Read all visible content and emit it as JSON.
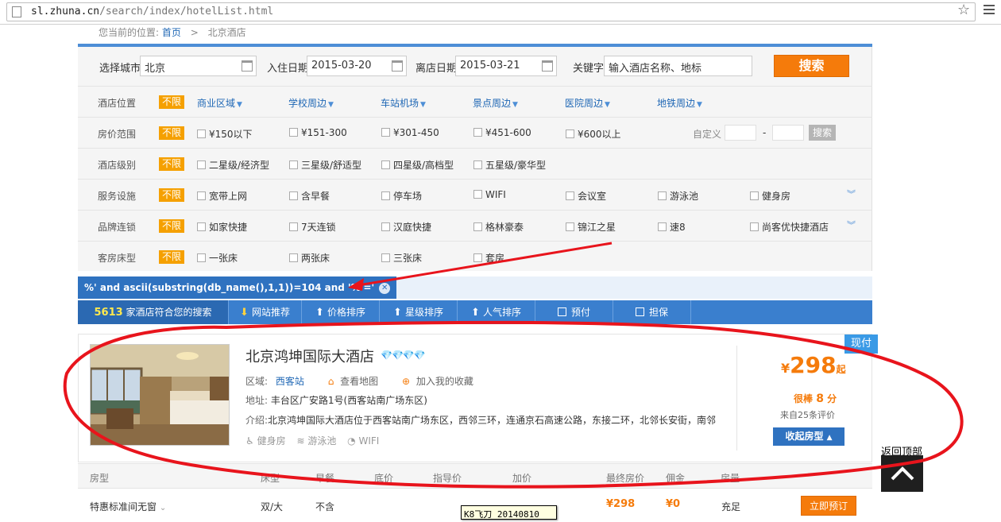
{
  "browser": {
    "url_host": "sl.zhuna.cn",
    "url_path": "/search/index/hotelList.html"
  },
  "breadcrumb": {
    "prefix": "您当前的位置:",
    "home": "首页",
    "sep": ">",
    "current": "北京酒店"
  },
  "search": {
    "city_label": "选择城市",
    "city_value": "北京",
    "checkin_label": "入住日期",
    "checkin_value": "2015-03-20",
    "checkout_label": "离店日期",
    "checkout_value": "2015-03-21",
    "keyword_label": "关键字",
    "keyword_placeholder": "输入酒店名称、地标",
    "button": "搜索"
  },
  "filters": {
    "unlimited": "不限",
    "location": {
      "label": "酒店位置",
      "options": [
        "商业区域",
        "学校周边",
        "车站机场",
        "景点周边",
        "医院周边",
        "地铁周边"
      ]
    },
    "price": {
      "label": "房价范围",
      "options": [
        "¥150以下",
        "¥151-300",
        "¥301-450",
        "¥451-600",
        "¥600以上"
      ],
      "custom_label": "自定义",
      "dash": "-",
      "custom_button": "搜索"
    },
    "star": {
      "label": "酒店级别",
      "options": [
        "二星级/经济型",
        "三星级/舒适型",
        "四星级/高档型",
        "五星级/豪华型"
      ]
    },
    "facility": {
      "label": "服务设施",
      "options": [
        "宽带上网",
        "含早餐",
        "停车场",
        "WIFI",
        "会议室",
        "游泳池",
        "健身房"
      ]
    },
    "brand": {
      "label": "品牌连锁",
      "options": [
        "如家快捷",
        "7天连锁",
        "汉庭快捷",
        "格林豪泰",
        "锦江之星",
        "速8",
        "尚客优快捷酒店"
      ]
    },
    "bed": {
      "label": "客房床型",
      "options": [
        "一张床",
        "两张床",
        "三张床",
        "套房"
      ]
    }
  },
  "active_tag": "%' and ascii(substring(db_name(),1,1))=104 and '%'='",
  "sortbar": {
    "count": "5613",
    "count_suffix": "家酒店符合您的搜索",
    "items": [
      "网站推荐",
      "价格排序",
      "星级排序",
      "人气排序",
      "预付",
      "担保"
    ]
  },
  "hotel": {
    "name": "北京鸿坤国际大酒店",
    "stars": 4,
    "district_label": "区域:",
    "district": "西客站",
    "map_link": "查看地图",
    "fav_link": "加入我的收藏",
    "address_label": "地址:",
    "address": "丰台区广安路1号(西客站南广场东区)",
    "intro_label": "介绍:",
    "intro": "北京鸿坤国际大酒店位于西客站南广场东区，西邻三环，连通京石高速公路，东接二环，北邻长安街，南邻",
    "facilities": [
      "健身房",
      "游泳池",
      "WIFI"
    ],
    "badge": "现付",
    "price_currency": "¥",
    "price": "298",
    "price_suffix": "起",
    "score_label": "很棒",
    "score": "8",
    "score_unit": "分",
    "reviews": "来自25条评价",
    "fold_button": "收起房型"
  },
  "room_table": {
    "headers": [
      "房型",
      "床型",
      "早餐",
      "底价",
      "指导价",
      "加价",
      "最终房价",
      "佣金",
      "房量"
    ],
    "row": {
      "name": "特惠标准间无窗",
      "bed": "双/大",
      "breakfast": "不含",
      "final_price": "¥298",
      "commission": "¥0",
      "stock": "充足",
      "book": "立即预订"
    }
  },
  "tooltip": "K8飞刀 20140810",
  "back_to_top": "返回顶部",
  "colors": {
    "accent_blue": "#2f72c0",
    "accent_orange": "#f57b0b",
    "annotation_red": "#e8141c"
  }
}
